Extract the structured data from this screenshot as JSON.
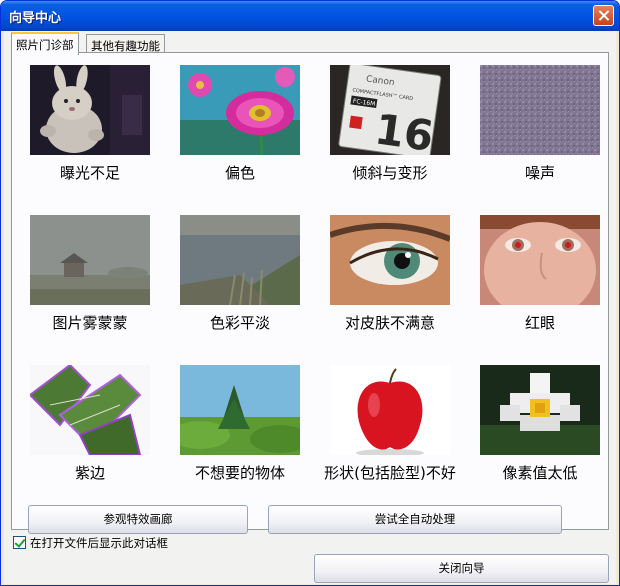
{
  "window": {
    "title": "向导中心"
  },
  "tabs": [
    {
      "label": "照片门诊部",
      "active": true
    },
    {
      "label": "其他有趣功能",
      "active": false
    }
  ],
  "grid": [
    {
      "label": "曝光不足",
      "image": "dark-plush-bunny-photo"
    },
    {
      "label": "偏色",
      "image": "pink-daisy-photo"
    },
    {
      "label": "倾斜与变形",
      "image": "compactflash-card-photo"
    },
    {
      "label": "噪声",
      "image": "purple-noise-photo"
    },
    {
      "label": "图片雾蒙蒙",
      "image": "foggy-lake-pavilion-photo"
    },
    {
      "label": "色彩平淡",
      "image": "dull-lake-reeds-photo"
    },
    {
      "label": "对皮肤不满意",
      "image": "close-up-eye-photo"
    },
    {
      "label": "红眼",
      "image": "red-eye-face-photo"
    },
    {
      "label": "紫边",
      "image": "leaves-purple-fringe-photo"
    },
    {
      "label": "不想要的物体",
      "image": "tree-on-grass-photo"
    },
    {
      "label": "形状(包括脸型)不好",
      "image": "red-apple-photo"
    },
    {
      "label": "像素值太低",
      "image": "pixelated-water-lily-photo"
    }
  ],
  "buttons": {
    "gallery": "参观特效画廊",
    "auto": "尝试全自动处理",
    "close": "关闭向导"
  },
  "checkbox": {
    "label": "在打开文件后显示此对话框",
    "checked": true
  },
  "cf_card": {
    "brand": "Canon",
    "line1": "COMPACTFLASH™ CARD",
    "model": "FC-16M",
    "size": "16"
  }
}
